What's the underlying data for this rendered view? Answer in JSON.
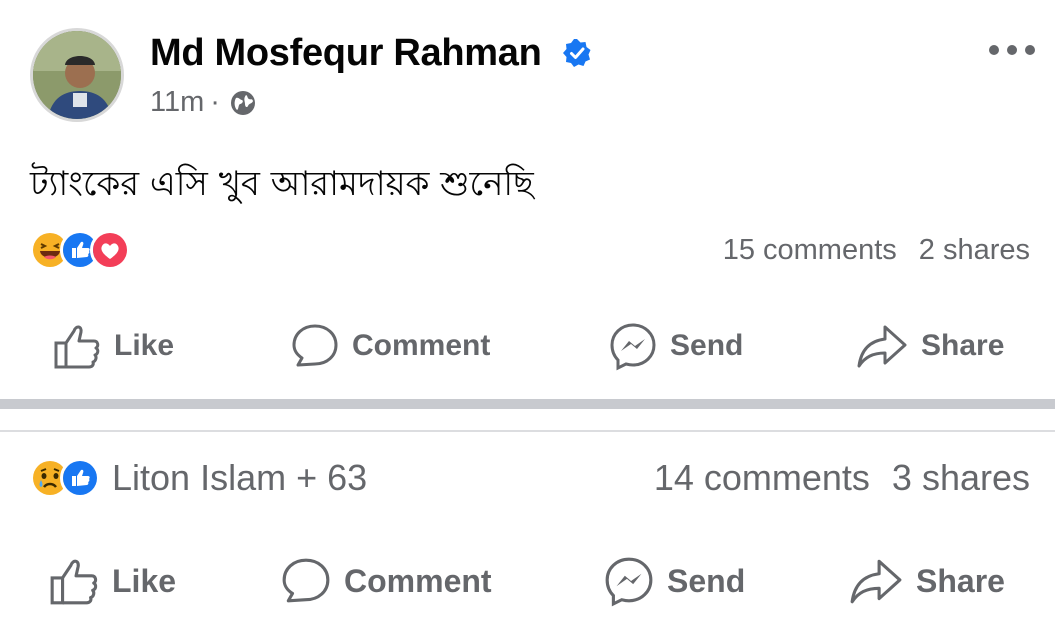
{
  "post1": {
    "author": "Md Mosfequr Rahman",
    "time": "11m",
    "separator": "·",
    "text": "ট্যাংকের এসি খুব আরামদায়ক শুনেছি",
    "stats": {
      "comments": "15 comments",
      "shares": "2 shares"
    },
    "reactions": [
      "haha-icon",
      "like-icon",
      "love-icon"
    ]
  },
  "post2": {
    "reaction_names": "Liton Islam + 63",
    "stats": {
      "comments": "14 comments",
      "shares": "3 shares"
    },
    "reactions": [
      "sad-icon",
      "like-icon"
    ]
  },
  "actions": {
    "like": "Like",
    "comment": "Comment",
    "send": "Send",
    "share": "Share"
  },
  "colors": {
    "verified": "#1877f2",
    "secondary_text": "#65676b",
    "like_blue": "#1877f2",
    "love_red": "#f33e58",
    "emoji_yellow": "#f7b125"
  }
}
